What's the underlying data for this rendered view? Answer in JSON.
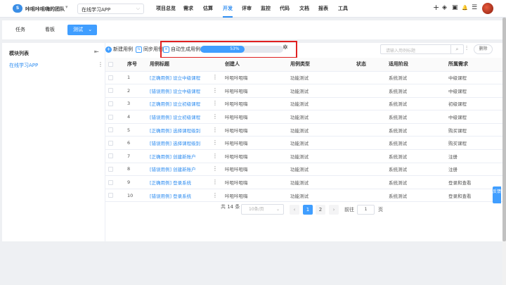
{
  "header": {
    "logo_text": "S",
    "team_name": "咔咀咔咀嗨的团队",
    "team_chevron": "▾",
    "project_select": "在线学习APP",
    "project_chevron": "⌵",
    "nav": [
      {
        "label": "项目总览",
        "active": false
      },
      {
        "label": "需求",
        "active": false
      },
      {
        "label": "估算",
        "active": false
      },
      {
        "label": "开发",
        "active": true
      },
      {
        "label": "评审",
        "active": false
      },
      {
        "label": "监控",
        "active": false
      },
      {
        "label": "代码",
        "active": false
      },
      {
        "label": "文档",
        "active": false
      },
      {
        "label": "报表",
        "active": false
      },
      {
        "label": "工具",
        "active": false
      }
    ],
    "icons": {
      "add": "+",
      "layers": "◈",
      "briefcase": "▣",
      "bell": "🔔",
      "settings": "☰"
    }
  },
  "subtabs": {
    "task": "任务",
    "board": "看板",
    "test": "测试",
    "test_chevron": "⌄"
  },
  "left_panel": {
    "title": "模块列表",
    "collapse_icon": "⇤",
    "item": "在线学习APP",
    "item_menu": "⋮"
  },
  "toolbar": {
    "new_case": "新建用例",
    "sync_case": "同步用例",
    "auto_generate": "自动生成用例",
    "progress_label": "53%",
    "progress_value": 0.53,
    "gear": "✲",
    "search_placeholder": "请输入用例标题",
    "search_icon": "⌕",
    "filter_icon": "⫶",
    "delete": "删除"
  },
  "table": {
    "columns": [
      "",
      "序号",
      "用例标题",
      "创建人",
      "用例类型",
      "状态",
      "适用阶段",
      "所属需求"
    ],
    "rows": [
      {
        "no": "1",
        "title": "[正确用例] 设立中级课程",
        "creator": "咔咀咔咀嗨",
        "type": "功能测试",
        "status": "",
        "stage": "系统测试",
        "req": "中级课程"
      },
      {
        "no": "2",
        "title": "[错误用例] 设立中级课程",
        "creator": "咔咀咔咀嗨",
        "type": "功能测试",
        "status": "",
        "stage": "系统测试",
        "req": "中级课程"
      },
      {
        "no": "3",
        "title": "[正确用例] 设立初级课程",
        "creator": "咔咀咔咀嗨",
        "type": "功能测试",
        "status": "",
        "stage": "系统测试",
        "req": "初级课程"
      },
      {
        "no": "4",
        "title": "[错误用例] 设立初级课程",
        "creator": "咔咀咔咀嗨",
        "type": "功能测试",
        "status": "",
        "stage": "系统测试",
        "req": "中级课程"
      },
      {
        "no": "5",
        "title": "[正确用例] 选择课程级别",
        "creator": "咔咀咔咀嗨",
        "type": "功能测试",
        "status": "",
        "stage": "系统测试",
        "req": "购买课程"
      },
      {
        "no": "6",
        "title": "[错误用例] 选择课程级别",
        "creator": "咔咀咔咀嗨",
        "type": "功能测试",
        "status": "",
        "stage": "系统测试",
        "req": "购买课程"
      },
      {
        "no": "7",
        "title": "[正确用例] 创建新账户",
        "creator": "咔咀咔咀嗨",
        "type": "功能测试",
        "status": "",
        "stage": "系统测试",
        "req": "注册"
      },
      {
        "no": "8",
        "title": "[错误用例] 创建新账户",
        "creator": "咔咀咔咀嗨",
        "type": "功能测试",
        "status": "",
        "stage": "系统测试",
        "req": "注册"
      },
      {
        "no": "9",
        "title": "[正确用例] 登录系统",
        "creator": "咔咀咔咀嗨",
        "type": "功能测试",
        "status": "",
        "stage": "系统测试",
        "req": "登录和查看"
      },
      {
        "no": "10",
        "title": "[错误用例] 登录系统",
        "creator": "咔咀咔咀嗨",
        "type": "功能测试",
        "status": "",
        "stage": "系统测试",
        "req": "登录和查看"
      }
    ]
  },
  "pagination": {
    "total": "共 14 条",
    "page_size": "10条/页",
    "page_size_chevron": "⌄",
    "prev": "‹",
    "pages": [
      "1",
      "2"
    ],
    "next": "›",
    "goto_label": "前往",
    "goto_value": "1",
    "goto_suffix": "页"
  },
  "feedback": "反馈"
}
